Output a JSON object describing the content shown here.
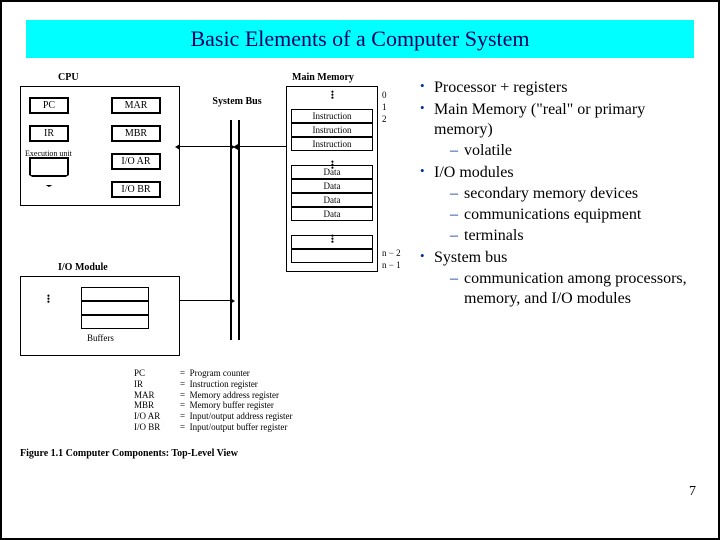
{
  "title": "Basic Elements of a Computer System",
  "bullets": [
    {
      "text": "Processor + registers"
    },
    {
      "text": "Main Memory (\"real\" or primary memory)",
      "sub": [
        "volatile"
      ]
    },
    {
      "text": "I/O modules",
      "sub": [
        "secondary memory devices",
        "communications equipment",
        "terminals"
      ]
    },
    {
      "text": "System bus",
      "sub": [
        "communication among processors, memory, and I/O modules"
      ]
    }
  ],
  "page_number": "7",
  "diagram": {
    "cpu_label": "CPU",
    "regs_left": [
      "PC",
      "IR"
    ],
    "regs_right": [
      "MAR",
      "MBR",
      "I/O AR",
      "I/O BR"
    ],
    "exec_unit": "Execution unit",
    "bus_label": "System Bus",
    "mem_label": "Main Memory",
    "mem_cells": [
      "Instruction",
      "Instruction",
      "Instruction",
      "Data",
      "Data",
      "Data",
      "Data"
    ],
    "mem_idx_top": [
      "0",
      "1",
      "2"
    ],
    "mem_idx_bot": [
      "n − 2",
      "n − 1"
    ],
    "io_label": "I/O Module",
    "io_buffers": "Buffers",
    "legend": [
      [
        "PC",
        "Program counter"
      ],
      [
        "IR",
        "Instruction register"
      ],
      [
        "MAR",
        "Memory address register"
      ],
      [
        "MBR",
        "Memory buffer register"
      ],
      [
        "I/O AR",
        "Input/output address register"
      ],
      [
        "I/O BR",
        "Input/output buffer register"
      ]
    ],
    "figure_caption": "Figure 1.1  Computer Components: Top-Level View"
  }
}
